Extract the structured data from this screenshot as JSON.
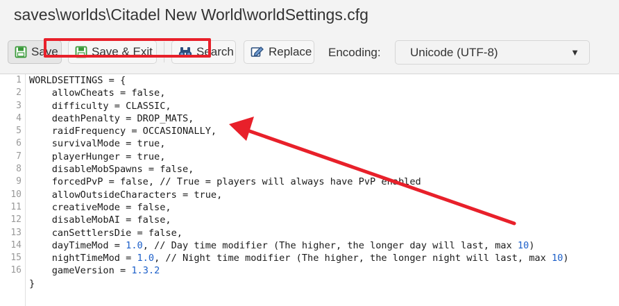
{
  "window": {
    "title": "saves\\worlds\\Citadel New World\\worldSettings.cfg"
  },
  "toolbar": {
    "save_label": "Save",
    "save_exit_label": "Save & Exit",
    "search_label": "Search",
    "replace_label": "Replace",
    "encoding_label": "Encoding:",
    "encoding_value": "Unicode (UTF-8)"
  },
  "editor": {
    "line_numbers": [
      "1",
      "2",
      "3",
      "4",
      "5",
      "6",
      "7",
      "8",
      "9",
      "10",
      "11",
      "12",
      "13",
      "14",
      "15",
      "16"
    ],
    "lines": [
      [
        {
          "t": "WORLDSETTINGS = {"
        }
      ],
      [
        {
          "t": "    allowCheats = false,"
        }
      ],
      [
        {
          "t": "    difficulty = CLASSIC,"
        }
      ],
      [
        {
          "t": "    deathPenalty = DROP_MATS,"
        }
      ],
      [
        {
          "t": "    raidFrequency = OCCASIONALLY,"
        }
      ],
      [
        {
          "t": "    survivalMode = true,"
        }
      ],
      [
        {
          "t": "    playerHunger = true,"
        }
      ],
      [
        {
          "t": "    disableMobSpawns = false,"
        }
      ],
      [
        {
          "t": "    forcedPvP = false, // True = players will always have PvP enabled"
        }
      ],
      [
        {
          "t": "    allowOutsideCharacters = true,"
        }
      ],
      [
        {
          "t": "    creativeMode = false,"
        }
      ],
      [
        {
          "t": "    disableMobAI = false,"
        }
      ],
      [
        {
          "t": "    canSettlersDie = false,"
        }
      ],
      [
        {
          "t": "    dayTimeMod = "
        },
        {
          "t": "1.0",
          "num": true
        },
        {
          "t": ", // Day time modifier (The higher, the longer day will last, max "
        },
        {
          "t": "10",
          "num": true
        },
        {
          "t": ")"
        }
      ],
      [
        {
          "t": "    nightTimeMod = "
        },
        {
          "t": "1.0",
          "num": true
        },
        {
          "t": ", // Night time modifier (The higher, the longer night will last, max "
        },
        {
          "t": "10",
          "num": true
        },
        {
          "t": ")"
        }
      ],
      [
        {
          "t": "    gameVersion = "
        },
        {
          "t": "1.3.2",
          "num": true
        }
      ],
      [
        {
          "t": "}"
        }
      ]
    ]
  },
  "colors": {
    "annotation": "#e8202a",
    "number": "#1c5fc9"
  },
  "icons": {
    "save": "floppy-disk-icon",
    "save_exit": "floppy-disk-exit-icon",
    "search": "binoculars-icon",
    "replace": "find-replace-icon",
    "dropdown": "chevron-down-icon"
  }
}
